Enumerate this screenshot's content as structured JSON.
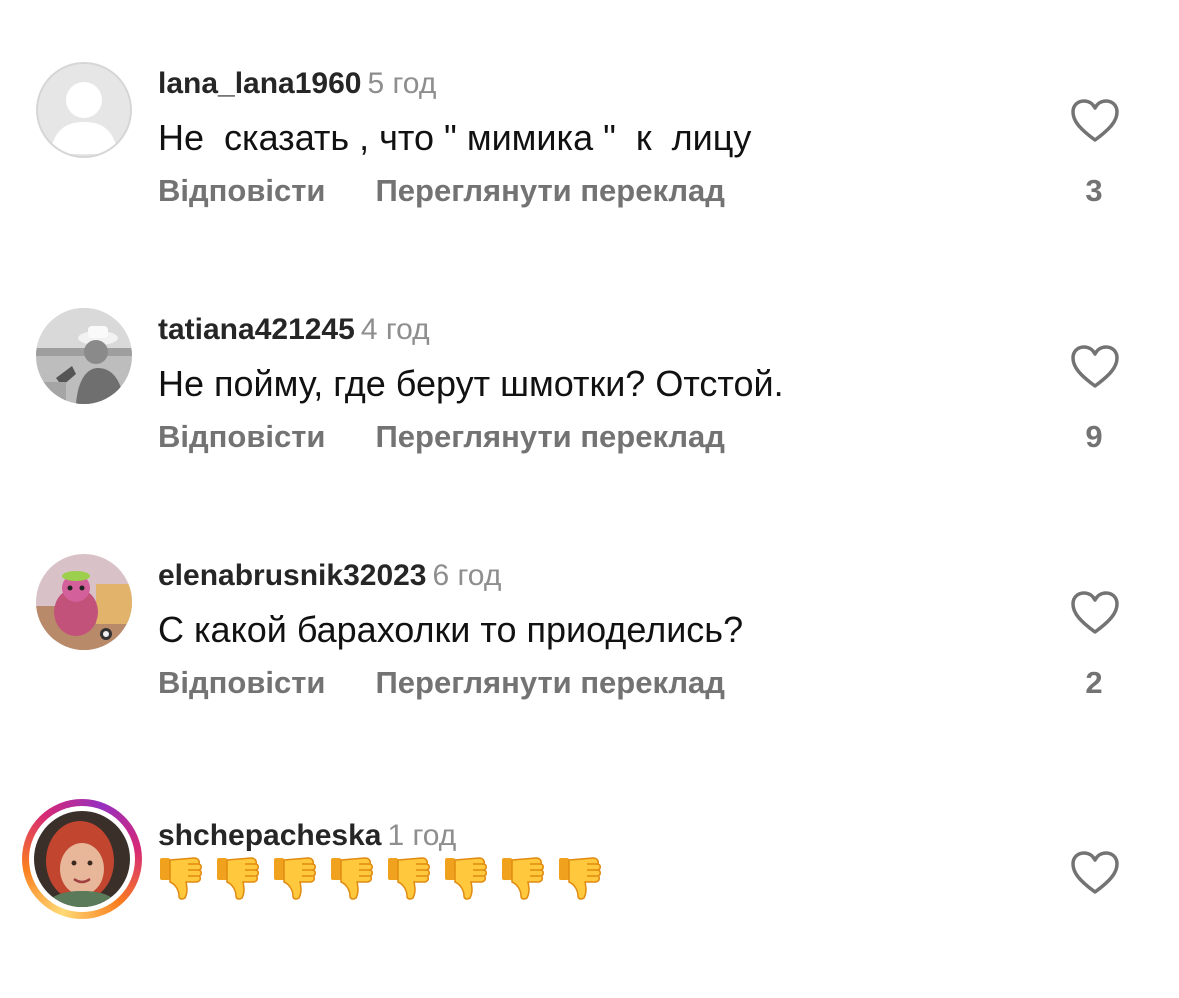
{
  "comments": [
    {
      "username": "lana_lana1960",
      "time": "5 год",
      "text": "Не  сказать , что \" мимика \"  к  лицу",
      "reply_label": "Відповісти",
      "translate_label": "Переглянути переклад",
      "likes": "3",
      "avatar": "default-avatar"
    },
    {
      "username": "tatiana421245",
      "time": "4 год",
      "text": "Не пойму, где берут шмотки? Отстой.",
      "reply_label": "Відповісти",
      "translate_label": "Переглянути переклад",
      "likes": "9",
      "avatar": "photo-avatar-grayscale"
    },
    {
      "username": "elenabrusnik32023",
      "time": "6 год",
      "text": "С какой барахолки то приоделись?",
      "reply_label": "Відповісти",
      "translate_label": "Переглянути переклад",
      "likes": "2",
      "avatar": "photo-avatar-toy"
    },
    {
      "username": "shchepacheska",
      "time": "1 год",
      "text_emoji": "thumbs-down",
      "text_emoji_count": 8,
      "avatar": "photo-avatar-story-ring"
    }
  ],
  "colors": {
    "username": "#262626",
    "secondary_text": "#737373",
    "timestamp": "#8e8e8e",
    "heart_outline": "#737373",
    "story_ring_start": "#feda75",
    "story_ring_end": "#962fbf",
    "thumb_emoji": "#ffc83d"
  }
}
